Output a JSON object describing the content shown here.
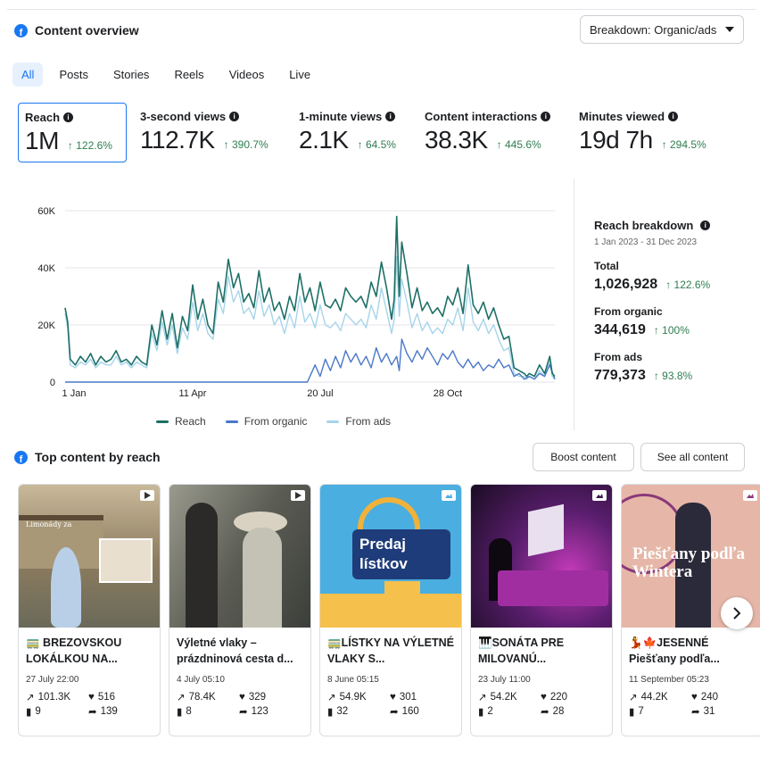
{
  "header": {
    "title": "Content overview",
    "icon": "facebook-icon"
  },
  "breakdown_dropdown": {
    "value": "Breakdown: Organic/ads"
  },
  "tabs": [
    {
      "label": "All",
      "active": true
    },
    {
      "label": "Posts"
    },
    {
      "label": "Stories"
    },
    {
      "label": "Reels"
    },
    {
      "label": "Videos"
    },
    {
      "label": "Live"
    }
  ],
  "metrics": [
    {
      "label": "Reach",
      "value": "1M",
      "delta": "↑ 122.6%",
      "selected": true
    },
    {
      "label": "3-second views",
      "value": "112.7K",
      "delta": "↑ 390.7%"
    },
    {
      "label": "1-minute views",
      "value": "2.1K",
      "delta": "↑ 64.5%"
    },
    {
      "label": "Content interactions",
      "value": "38.3K",
      "delta": "↑ 445.6%"
    },
    {
      "label": "Minutes viewed",
      "value": "19d 7h",
      "delta": "↑ 294.5%"
    }
  ],
  "chart_data": {
    "type": "line",
    "x_tick_labels": [
      "1 Jan",
      "11 Apr",
      "20 Jul",
      "28 Oct"
    ],
    "y_tick_labels": [
      "0",
      "20K",
      "40K",
      "60K"
    ],
    "ylim": [
      0,
      60000
    ],
    "x_range_days": [
      0,
      365
    ],
    "grid": true,
    "legend_position": "bottom",
    "series": [
      {
        "name": "Reach",
        "color": "#1d7066",
        "points": [
          [
            0,
            26000
          ],
          [
            2,
            21000
          ],
          [
            4,
            8000
          ],
          [
            8,
            6000
          ],
          [
            12,
            9000
          ],
          [
            16,
            7000
          ],
          [
            20,
            10000
          ],
          [
            24,
            6000
          ],
          [
            28,
            9000
          ],
          [
            32,
            7000
          ],
          [
            36,
            8000
          ],
          [
            40,
            11000
          ],
          [
            44,
            7000
          ],
          [
            48,
            8000
          ],
          [
            52,
            6000
          ],
          [
            56,
            9000
          ],
          [
            60,
            7000
          ],
          [
            64,
            6000
          ],
          [
            68,
            20000
          ],
          [
            72,
            13000
          ],
          [
            76,
            25000
          ],
          [
            80,
            15000
          ],
          [
            84,
            24000
          ],
          [
            88,
            12000
          ],
          [
            92,
            23000
          ],
          [
            96,
            18000
          ],
          [
            100,
            34000
          ],
          [
            104,
            22000
          ],
          [
            108,
            29000
          ],
          [
            112,
            20000
          ],
          [
            116,
            17000
          ],
          [
            120,
            35000
          ],
          [
            124,
            28000
          ],
          [
            128,
            43000
          ],
          [
            132,
            33000
          ],
          [
            136,
            38000
          ],
          [
            140,
            28000
          ],
          [
            144,
            31000
          ],
          [
            148,
            26000
          ],
          [
            152,
            39000
          ],
          [
            156,
            28000
          ],
          [
            160,
            33000
          ],
          [
            164,
            25000
          ],
          [
            168,
            28000
          ],
          [
            172,
            22000
          ],
          [
            176,
            30000
          ],
          [
            180,
            25000
          ],
          [
            184,
            38000
          ],
          [
            188,
            28000
          ],
          [
            192,
            33000
          ],
          [
            196,
            25000
          ],
          [
            200,
            35000
          ],
          [
            204,
            27000
          ],
          [
            208,
            26000
          ],
          [
            212,
            29000
          ],
          [
            216,
            25000
          ],
          [
            220,
            33000
          ],
          [
            224,
            30000
          ],
          [
            228,
            28000
          ],
          [
            232,
            30000
          ],
          [
            236,
            26000
          ],
          [
            240,
            35000
          ],
          [
            244,
            30000
          ],
          [
            248,
            42000
          ],
          [
            252,
            33000
          ],
          [
            256,
            22000
          ],
          [
            258,
            29000
          ],
          [
            260,
            58000
          ],
          [
            262,
            30000
          ],
          [
            264,
            49000
          ],
          [
            268,
            38000
          ],
          [
            272,
            26000
          ],
          [
            276,
            33000
          ],
          [
            280,
            25000
          ],
          [
            284,
            28000
          ],
          [
            288,
            24000
          ],
          [
            292,
            26000
          ],
          [
            296,
            23000
          ],
          [
            300,
            30000
          ],
          [
            304,
            27000
          ],
          [
            308,
            33000
          ],
          [
            312,
            24000
          ],
          [
            316,
            41000
          ],
          [
            320,
            27000
          ],
          [
            324,
            24000
          ],
          [
            328,
            28000
          ],
          [
            332,
            22000
          ],
          [
            336,
            26000
          ],
          [
            340,
            20000
          ],
          [
            344,
            15000
          ],
          [
            348,
            16000
          ],
          [
            352,
            5000
          ],
          [
            356,
            4000
          ],
          [
            360,
            3000
          ],
          [
            362,
            2000
          ],
          [
            364,
            3000
          ],
          [
            368,
            2000
          ],
          [
            372,
            6000
          ],
          [
            376,
            3000
          ],
          [
            380,
            9000
          ],
          [
            382,
            3000
          ],
          [
            384,
            2000
          ]
        ]
      },
      {
        "name": "From organic",
        "color": "#4a78c8",
        "points": [
          [
            0,
            0
          ],
          [
            190,
            0
          ],
          [
            192,
            2000
          ],
          [
            196,
            6000
          ],
          [
            200,
            2000
          ],
          [
            204,
            8000
          ],
          [
            208,
            4000
          ],
          [
            212,
            9000
          ],
          [
            216,
            5000
          ],
          [
            220,
            11000
          ],
          [
            224,
            7000
          ],
          [
            228,
            10000
          ],
          [
            232,
            6000
          ],
          [
            236,
            9000
          ],
          [
            240,
            5000
          ],
          [
            244,
            12000
          ],
          [
            248,
            7000
          ],
          [
            252,
            10000
          ],
          [
            256,
            6000
          ],
          [
            260,
            9000
          ],
          [
            262,
            4000
          ],
          [
            264,
            15000
          ],
          [
            268,
            10000
          ],
          [
            272,
            7000
          ],
          [
            276,
            11000
          ],
          [
            280,
            8000
          ],
          [
            284,
            12000
          ],
          [
            288,
            9000
          ],
          [
            292,
            6000
          ],
          [
            296,
            10000
          ],
          [
            300,
            8000
          ],
          [
            304,
            11000
          ],
          [
            308,
            7000
          ],
          [
            312,
            5000
          ],
          [
            316,
            8000
          ],
          [
            320,
            5000
          ],
          [
            324,
            7000
          ],
          [
            328,
            4000
          ],
          [
            332,
            6000
          ],
          [
            336,
            5000
          ],
          [
            340,
            8000
          ],
          [
            344,
            5000
          ],
          [
            348,
            6000
          ],
          [
            352,
            2000
          ],
          [
            356,
            3000
          ],
          [
            360,
            1000
          ],
          [
            364,
            2000
          ],
          [
            368,
            1000
          ],
          [
            372,
            3000
          ],
          [
            376,
            2000
          ],
          [
            380,
            6000
          ],
          [
            384,
            1000
          ]
        ]
      },
      {
        "name": "From ads",
        "color": "#a6d4ea",
        "points": [
          [
            0,
            24000
          ],
          [
            2,
            19000
          ],
          [
            4,
            6000
          ],
          [
            8,
            5000
          ],
          [
            12,
            7000
          ],
          [
            16,
            6000
          ],
          [
            20,
            8000
          ],
          [
            24,
            5000
          ],
          [
            28,
            7000
          ],
          [
            32,
            6000
          ],
          [
            36,
            6000
          ],
          [
            40,
            9000
          ],
          [
            44,
            6000
          ],
          [
            48,
            7000
          ],
          [
            52,
            5000
          ],
          [
            56,
            7000
          ],
          [
            60,
            6000
          ],
          [
            64,
            5000
          ],
          [
            68,
            17000
          ],
          [
            72,
            11000
          ],
          [
            76,
            21000
          ],
          [
            80,
            13000
          ],
          [
            84,
            20000
          ],
          [
            88,
            10000
          ],
          [
            92,
            19000
          ],
          [
            96,
            15000
          ],
          [
            100,
            28000
          ],
          [
            104,
            18000
          ],
          [
            108,
            24000
          ],
          [
            112,
            17000
          ],
          [
            116,
            15000
          ],
          [
            120,
            29000
          ],
          [
            124,
            24000
          ],
          [
            128,
            37000
          ],
          [
            132,
            28000
          ],
          [
            136,
            32000
          ],
          [
            140,
            24000
          ],
          [
            144,
            26000
          ],
          [
            148,
            22000
          ],
          [
            152,
            32000
          ],
          [
            156,
            23000
          ],
          [
            160,
            27000
          ],
          [
            164,
            20000
          ],
          [
            168,
            23000
          ],
          [
            172,
            17000
          ],
          [
            176,
            24000
          ],
          [
            180,
            19000
          ],
          [
            184,
            30000
          ],
          [
            188,
            21000
          ],
          [
            192,
            24000
          ],
          [
            196,
            19000
          ],
          [
            200,
            27000
          ],
          [
            204,
            20000
          ],
          [
            208,
            19000
          ],
          [
            212,
            21000
          ],
          [
            216,
            18000
          ],
          [
            220,
            24000
          ],
          [
            224,
            22000
          ],
          [
            228,
            20000
          ],
          [
            232,
            22000
          ],
          [
            236,
            19000
          ],
          [
            240,
            27000
          ],
          [
            244,
            22000
          ],
          [
            248,
            33000
          ],
          [
            252,
            25000
          ],
          [
            256,
            17000
          ],
          [
            258,
            22000
          ],
          [
            260,
            44000
          ],
          [
            262,
            23000
          ],
          [
            264,
            36000
          ],
          [
            268,
            28000
          ],
          [
            272,
            19000
          ],
          [
            276,
            24000
          ],
          [
            280,
            18000
          ],
          [
            284,
            21000
          ],
          [
            288,
            17000
          ],
          [
            292,
            19000
          ],
          [
            296,
            17000
          ],
          [
            300,
            22000
          ],
          [
            304,
            20000
          ],
          [
            308,
            26000
          ],
          [
            312,
            18000
          ],
          [
            316,
            33000
          ],
          [
            320,
            21000
          ],
          [
            324,
            18000
          ],
          [
            328,
            22000
          ],
          [
            332,
            17000
          ],
          [
            336,
            20000
          ],
          [
            340,
            15000
          ],
          [
            344,
            11000
          ],
          [
            348,
            12000
          ],
          [
            352,
            3000
          ],
          [
            356,
            2000
          ],
          [
            360,
            2000
          ],
          [
            362,
            1000
          ],
          [
            364,
            2000
          ],
          [
            368,
            1000
          ],
          [
            372,
            4000
          ],
          [
            376,
            2000
          ],
          [
            380,
            7000
          ],
          [
            382,
            2000
          ],
          [
            384,
            1000
          ]
        ]
      }
    ]
  },
  "reach_breakdown": {
    "title": "Reach breakdown",
    "date_range": "1 Jan 2023 - 31 Dec 2023",
    "total_label": "Total",
    "total_value": "1,026,928",
    "total_delta": "↑ 122.6%",
    "organic_label": "From organic",
    "organic_value": "344,619",
    "organic_delta": "↑ 100%",
    "ads_label": "From ads",
    "ads_value": "779,373",
    "ads_delta": "↑ 93.8%"
  },
  "top_content": {
    "title": "Top content by reach",
    "boost_label": "Boost content",
    "see_all_label": "See all content",
    "posts": [
      {
        "title": "🚃 BREZOVSKOU LOKÁLKOU NA...",
        "date": "27 July 22:00",
        "reach": "101.3K",
        "likes": "516",
        "comments": "9",
        "shares": "139",
        "type_icon": "video-icon",
        "thumb_color": "#b8a680",
        "sign_text": "Limonády za"
      },
      {
        "title": "Výletné vlaky – prázdninová cesta d...",
        "date": "4 July 05:10",
        "reach": "78.4K",
        "likes": "329",
        "comments": "8",
        "shares": "123",
        "type_icon": "video-icon",
        "thumb_color": "#6b6b62"
      },
      {
        "title": "🚃LÍSTKY NA VÝLETNÉ VLAKY S...",
        "date": "8 June 05:15",
        "reach": "54.9K",
        "likes": "301",
        "comments": "32",
        "shares": "160",
        "type_icon": "photo-icon",
        "thumb_color": "#4aaee0",
        "sign_text": "Predaj lístkov"
      },
      {
        "title": "🎹SONÁTA PRE MILOVANÚ...",
        "date": "23 July 11:00",
        "reach": "54.2K",
        "likes": "220",
        "comments": "2",
        "shares": "28",
        "type_icon": "photo-icon",
        "thumb_color": "#3a1a4e"
      },
      {
        "title": "💃🍁JESENNÉ Piešťany podľa...",
        "date": "11 September 05:23",
        "reach": "44.2K",
        "likes": "240",
        "comments": "7",
        "shares": "31",
        "type_icon": "photo-icon",
        "thumb_color": "#d8a49a",
        "sign_text": "Piešťany podľa Wintera"
      }
    ]
  }
}
